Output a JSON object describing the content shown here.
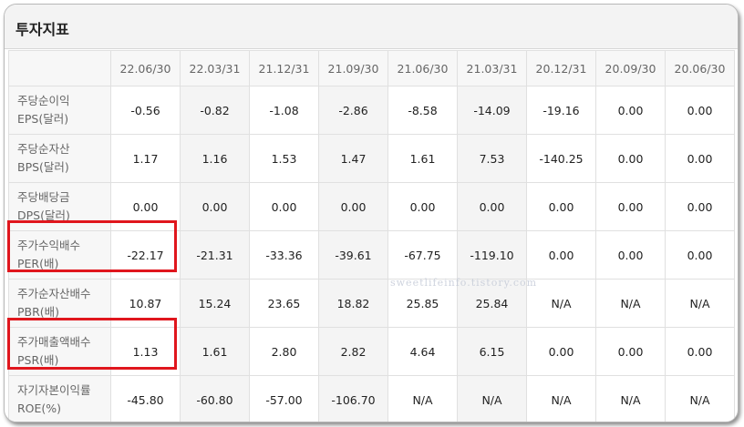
{
  "title": "투자지표",
  "columns": [
    "22.06/30",
    "22.03/31",
    "21.12/31",
    "21.09/30",
    "21.06/30",
    "21.03/31",
    "20.12/31",
    "20.09/30",
    "20.06/30"
  ],
  "rows": [
    {
      "label1": "주당순이익",
      "label2": "EPS(달러)",
      "values": [
        "-0.56",
        "-0.82",
        "-1.08",
        "-2.86",
        "-8.58",
        "-14.09",
        "-19.16",
        "0.00",
        "0.00"
      ]
    },
    {
      "label1": "주당순자산",
      "label2": "BPS(달러)",
      "values": [
        "1.17",
        "1.16",
        "1.53",
        "1.47",
        "1.61",
        "7.53",
        "-140.25",
        "0.00",
        "0.00"
      ]
    },
    {
      "label1": "주당배당금",
      "label2": "DPS(달러)",
      "values": [
        "0.00",
        "0.00",
        "0.00",
        "0.00",
        "0.00",
        "0.00",
        "0.00",
        "0.00",
        "0.00"
      ]
    },
    {
      "label1": "주가수익배수",
      "label2": "PER(배)",
      "values": [
        "-22.17",
        "-21.31",
        "-33.36",
        "-39.61",
        "-67.75",
        "-119.10",
        "0.00",
        "0.00",
        "0.00"
      ]
    },
    {
      "label1": "주가순자산배수",
      "label2": "PBR(배)",
      "values": [
        "10.87",
        "15.24",
        "23.65",
        "18.82",
        "25.85",
        "25.84",
        "N/A",
        "N/A",
        "N/A"
      ]
    },
    {
      "label1": "주가매출액배수",
      "label2": "PSR(배)",
      "values": [
        "1.13",
        "1.61",
        "2.80",
        "2.82",
        "4.64",
        "6.15",
        "0.00",
        "0.00",
        "0.00"
      ]
    },
    {
      "label1": "자기자본이익률",
      "label2": "ROE(%)",
      "values": [
        "-45.80",
        "-60.80",
        "-57.00",
        "-106.70",
        "N/A",
        "N/A",
        "N/A",
        "N/A",
        "N/A"
      ]
    }
  ],
  "watermark": "sweetlifeinfo.tistory.com",
  "highlight_color": "#e0161d"
}
